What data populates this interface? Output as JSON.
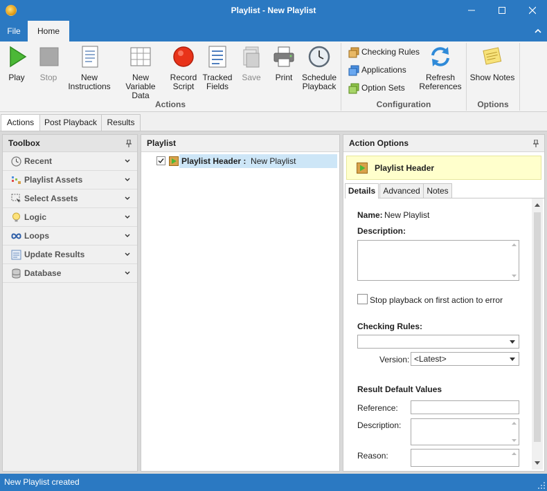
{
  "window": {
    "title": "Playlist - New Playlist"
  },
  "ribbon_tabs": {
    "file": "File",
    "home": "Home"
  },
  "ribbon": {
    "actions": {
      "play": "Play",
      "stop": "Stop",
      "new_instructions_1": "New",
      "new_instructions_2": "Instructions",
      "new_variable_data_1": "New Variable",
      "new_variable_data_2": "Data",
      "record_script_1": "Record",
      "record_script_2": "Script",
      "tracked_fields_1": "Tracked",
      "tracked_fields_2": "Fields",
      "save": "Save",
      "print": "Print",
      "schedule_playback_1": "Schedule",
      "schedule_playback_2": "Playback",
      "group_label": "Actions"
    },
    "configuration": {
      "checking_rules": "Checking Rules",
      "applications": "Applications",
      "option_sets": "Option Sets",
      "refresh_references_1": "Refresh",
      "refresh_references_2": "References",
      "group_label": "Configuration"
    },
    "options": {
      "show_notes": "Show Notes",
      "group_label": "Options"
    }
  },
  "doc_tabs": [
    "Actions",
    "Post Playback",
    "Results"
  ],
  "toolbox": {
    "title": "Toolbox",
    "items": [
      {
        "label": "Recent",
        "icon": "clock-icon"
      },
      {
        "label": "Playlist Assets",
        "icon": "playlist-assets-icon"
      },
      {
        "label": "Select Assets",
        "icon": "select-icon"
      },
      {
        "label": "Logic",
        "icon": "lightbulb-icon"
      },
      {
        "label": "Loops",
        "icon": "infinity-icon"
      },
      {
        "label": "Update Results",
        "icon": "update-results-icon"
      },
      {
        "label": "Database",
        "icon": "database-icon"
      }
    ]
  },
  "playlist": {
    "title": "Playlist",
    "row": {
      "checked": true,
      "label": "Playlist Header :",
      "value": "New Playlist"
    }
  },
  "action_options": {
    "title": "Action Options",
    "header_name": "Playlist Header",
    "tabs": [
      "Details",
      "Advanced",
      "Notes"
    ],
    "details": {
      "name_label": "Name:",
      "name_value": "New Playlist",
      "description_label": "Description:",
      "stop_playback_label": "Stop playback on first action to error",
      "stop_playback_checked": false,
      "checking_rules_label": "Checking Rules:",
      "checking_rules_value": "",
      "version_label": "Version:",
      "version_value": "<Latest>",
      "result_defaults_label": "Result Default Values",
      "reference_label": "Reference:",
      "result_description_label": "Description:",
      "reason_label": "Reason:"
    }
  },
  "status": {
    "text": "New Playlist created"
  },
  "colors": {
    "accent": "#2b79c2",
    "selection": "#cde6f7",
    "header_highlight": "#ffffcc"
  }
}
